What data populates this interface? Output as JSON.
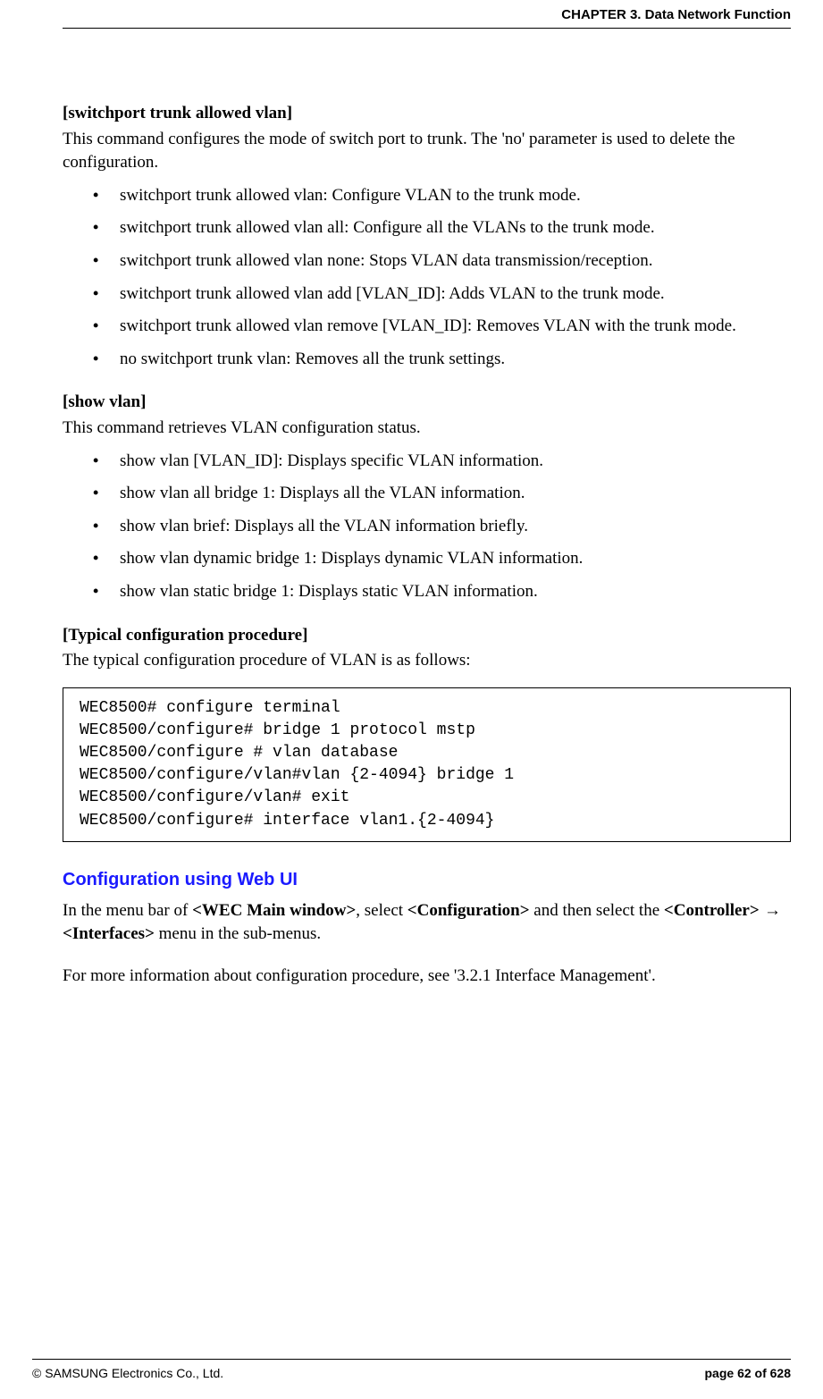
{
  "header": {
    "chapter": "CHAPTER 3. Data Network Function"
  },
  "section1": {
    "title": "[switchport trunk allowed vlan]",
    "desc": "This command configures the mode of switch port to trunk. The 'no' parameter is used to delete the configuration.",
    "items": [
      "switchport trunk allowed vlan: Configure VLAN to the trunk mode.",
      "switchport trunk allowed vlan all: Configure all the VLANs to the trunk mode.",
      "switchport trunk allowed vlan none: Stops VLAN data transmission/reception.",
      "switchport trunk allowed vlan add [VLAN_ID]: Adds VLAN to the trunk mode.",
      "switchport trunk allowed vlan remove [VLAN_ID]: Removes VLAN with the trunk mode.",
      "no switchport trunk vlan: Removes all the trunk settings."
    ]
  },
  "section2": {
    "title": "[show vlan]",
    "desc": "This command retrieves VLAN configuration status.",
    "items": [
      "show vlan [VLAN_ID]: Displays specific VLAN information.",
      "show vlan all bridge 1: Displays all the VLAN information.",
      "show vlan brief: Displays all the VLAN information briefly.",
      "show vlan dynamic bridge 1: Displays dynamic VLAN information.",
      "show vlan static bridge 1: Displays static VLAN information."
    ]
  },
  "section3": {
    "title": "[Typical configuration procedure]",
    "desc": "The typical configuration procedure of VLAN is as follows:",
    "code": "WEC8500# configure terminal\nWEC8500/configure# bridge 1 protocol mstp\nWEC8500/configure # vlan database\nWEC8500/configure/vlan#vlan {2-4094} bridge 1\nWEC8500/configure/vlan# exit\nWEC8500/configure# interface vlan1.{2-4094}"
  },
  "webui": {
    "title": "Configuration using Web UI",
    "p1_a": "In the menu bar of ",
    "p1_b": "<WEC Main window>",
    "p1_c": ", select ",
    "p1_d": "<Configuration>",
    "p1_e": " and then select the ",
    "p1_f": "<Controller>",
    "p1_g": " → ",
    "p1_h": "<Interfaces>",
    "p1_i": " menu in the sub-menus.",
    "p2": "For more information about configuration procedure, see '3.2.1 Interface Management'."
  },
  "footer": {
    "copyright": "© SAMSUNG Electronics Co., Ltd.",
    "page": "page 62 of 628"
  }
}
